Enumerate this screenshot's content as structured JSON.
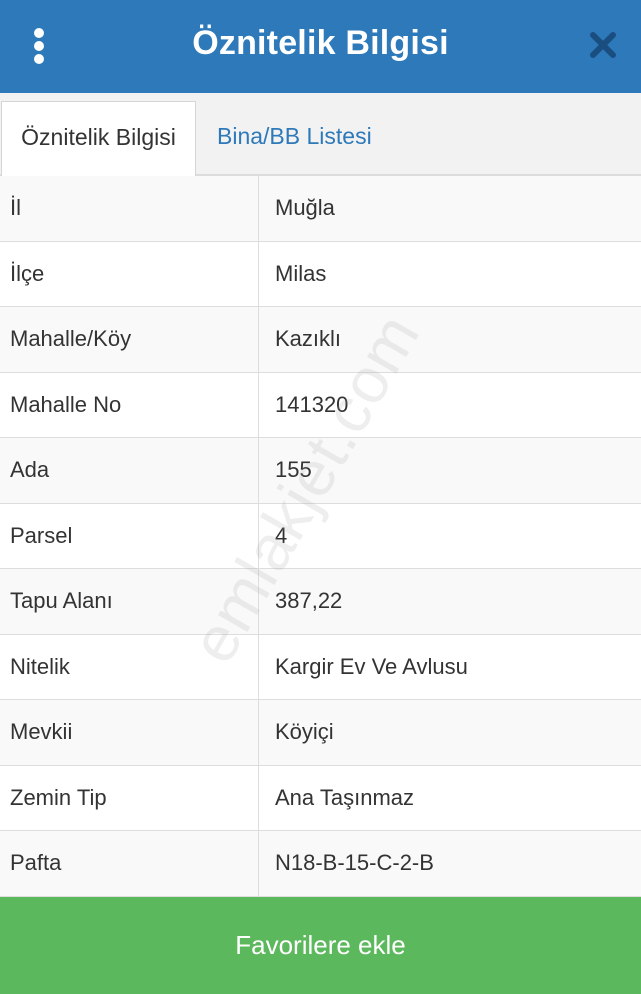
{
  "header": {
    "title": "Öznitelik Bilgisi",
    "menu_icon": "more-vertical-icon",
    "close_icon": "close-icon",
    "background_color": "#2e79b9"
  },
  "tabs": [
    {
      "label": "Öznitelik Bilgisi",
      "active": true
    },
    {
      "label": "Bina/BB Listesi",
      "active": false
    }
  ],
  "attributes": [
    {
      "key": "İl",
      "value": "Muğla"
    },
    {
      "key": "İlçe",
      "value": "Milas"
    },
    {
      "key": "Mahalle/Köy",
      "value": "Kazıklı"
    },
    {
      "key": "Mahalle No",
      "value": "141320"
    },
    {
      "key": "Ada",
      "value": "155"
    },
    {
      "key": "Parsel",
      "value": "4"
    },
    {
      "key": "Tapu Alanı",
      "value": "387,22"
    },
    {
      "key": "Nitelik",
      "value": "Kargir Ev Ve Avlusu"
    },
    {
      "key": "Mevkii",
      "value": "Köyiçi"
    },
    {
      "key": "Zemin Tip",
      "value": "Ana Taşınmaz"
    },
    {
      "key": "Pafta",
      "value": "N18-B-15-C-2-B"
    }
  ],
  "watermark": "emlakjet.com",
  "footer": {
    "button_label": "Favorilere ekle",
    "button_color": "#5cb85c"
  }
}
